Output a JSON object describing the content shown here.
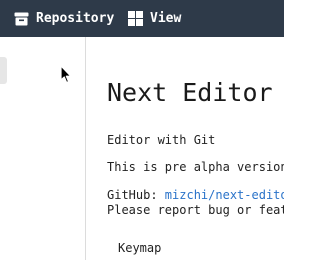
{
  "toolbar": {
    "repository_label": "Repository",
    "view_label": "View",
    "repository_icon": "archive-icon",
    "view_icon": "grid-icon"
  },
  "content": {
    "title": "Next Editor v",
    "subtitle": "Editor with Git",
    "notice": "This is pre alpha version",
    "github_label": "GitHub: ",
    "github_link": "mizchi/next-editor",
    "report_text": "Please report bug or featu",
    "keymap_label": "Keymap"
  },
  "colors": {
    "toolbar_bg": "#2e3a49",
    "link": "#2a73c9"
  }
}
